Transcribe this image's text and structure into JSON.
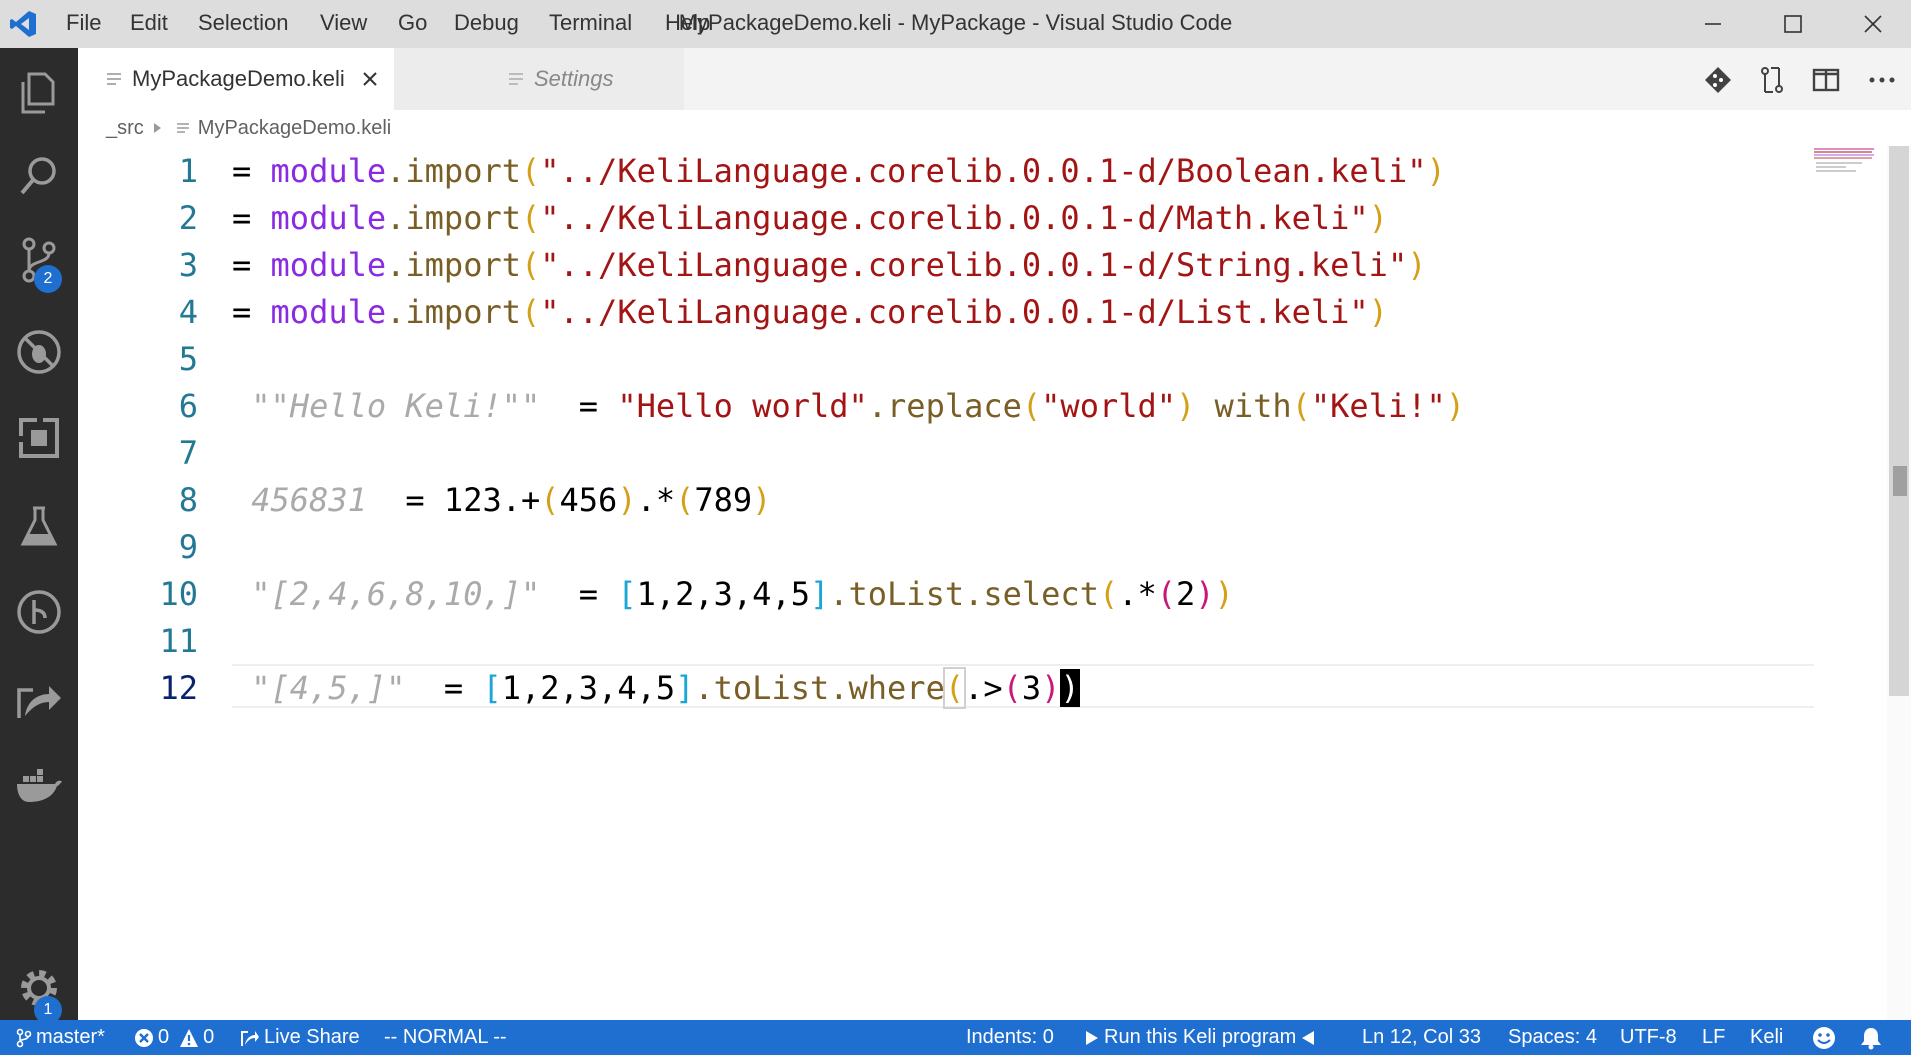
{
  "window": {
    "title": "MyPackageDemo.keli - MyPackage - Visual Studio Code",
    "app_icon": "vscode-icon"
  },
  "menu": [
    "File",
    "Edit",
    "Selection",
    "View",
    "Go",
    "Debug",
    "Terminal",
    "Help"
  ],
  "activity": {
    "items": [
      "explorer-icon",
      "search-icon",
      "source-control-icon",
      "debug-icon",
      "extensions-icon",
      "test-icon",
      "git-graph-icon",
      "live-share-icon",
      "docker-icon"
    ],
    "scm_badge": "2",
    "settings_badge": "1"
  },
  "tabs": [
    {
      "label": "MyPackageDemo.keli",
      "active": true
    },
    {
      "label": "Settings",
      "active": false
    }
  ],
  "breadcrumb": {
    "folder": "_src",
    "file": "MyPackageDemo.keli"
  },
  "editor": {
    "line_numbers": [
      "1",
      "2",
      "3",
      "4",
      "5",
      "6",
      "7",
      "8",
      "9",
      "10",
      "11",
      "12"
    ],
    "current_line": "12",
    "lines": [
      [
        {
          "t": "= ",
          "c": "eq"
        },
        {
          "t": "module",
          "c": "kw"
        },
        {
          "t": ".import",
          "c": "dot"
        },
        {
          "t": "(",
          "c": "p1"
        },
        {
          "t": "\"../KeliLanguage.corelib.0.0.1-d/Boolean.keli\"",
          "c": "str"
        },
        {
          "t": ")",
          "c": "p1"
        }
      ],
      [
        {
          "t": "= ",
          "c": "eq"
        },
        {
          "t": "module",
          "c": "kw"
        },
        {
          "t": ".import",
          "c": "dot"
        },
        {
          "t": "(",
          "c": "p1"
        },
        {
          "t": "\"../KeliLanguage.corelib.0.0.1-d/Math.keli\"",
          "c": "str"
        },
        {
          "t": ")",
          "c": "p1"
        }
      ],
      [
        {
          "t": "= ",
          "c": "eq"
        },
        {
          "t": "module",
          "c": "kw"
        },
        {
          "t": ".import",
          "c": "dot"
        },
        {
          "t": "(",
          "c": "p1"
        },
        {
          "t": "\"../KeliLanguage.corelib.0.0.1-d/String.keli\"",
          "c": "str"
        },
        {
          "t": ")",
          "c": "p1"
        }
      ],
      [
        {
          "t": "= ",
          "c": "eq"
        },
        {
          "t": "module",
          "c": "kw"
        },
        {
          "t": ".import",
          "c": "dot"
        },
        {
          "t": "(",
          "c": "p1"
        },
        {
          "t": "\"../KeliLanguage.corelib.0.0.1-d/List.keli\"",
          "c": "str"
        },
        {
          "t": ")",
          "c": "p1"
        }
      ],
      [],
      [
        {
          "t": " \"\"Hello Keli!\"\" ",
          "c": "res"
        },
        {
          "t": " = ",
          "c": "eq"
        },
        {
          "t": "\"Hello world\"",
          "c": "str"
        },
        {
          "t": ".replace",
          "c": "fn"
        },
        {
          "t": "(",
          "c": "p1"
        },
        {
          "t": "\"world\"",
          "c": "str"
        },
        {
          "t": ")",
          "c": "p1"
        },
        {
          "t": " with",
          "c": "fn"
        },
        {
          "t": "(",
          "c": "p1"
        },
        {
          "t": "\"Keli!\"",
          "c": "str"
        },
        {
          "t": ")",
          "c": "p1"
        }
      ],
      [],
      [
        {
          "t": " 456831 ",
          "c": "res"
        },
        {
          "t": " = ",
          "c": "eq"
        },
        {
          "t": "123.+",
          "c": "num"
        },
        {
          "t": "(",
          "c": "p1"
        },
        {
          "t": "456",
          "c": "num"
        },
        {
          "t": ")",
          "c": "p1"
        },
        {
          "t": ".*",
          "c": "num"
        },
        {
          "t": "(",
          "c": "p1"
        },
        {
          "t": "789",
          "c": "num"
        },
        {
          "t": ")",
          "c": "p1"
        }
      ],
      [],
      [
        {
          "t": " \"[2,4,6,8,10,]\" ",
          "c": "res"
        },
        {
          "t": " = ",
          "c": "eq"
        },
        {
          "t": "[",
          "c": "p3"
        },
        {
          "t": "1,2,3,4,5",
          "c": "num"
        },
        {
          "t": "]",
          "c": "p3"
        },
        {
          "t": ".toList.select",
          "c": "fn"
        },
        {
          "t": "(",
          "c": "p1"
        },
        {
          "t": ".*",
          "c": "num"
        },
        {
          "t": "(",
          "c": "p2"
        },
        {
          "t": "2",
          "c": "num"
        },
        {
          "t": ")",
          "c": "p2"
        },
        {
          "t": ")",
          "c": "p1"
        }
      ],
      [],
      [
        {
          "t": " \"[4,5,]\" ",
          "c": "res"
        },
        {
          "t": " = ",
          "c": "eq"
        },
        {
          "t": "[",
          "c": "p3"
        },
        {
          "t": "1,2,3,4,5",
          "c": "num"
        },
        {
          "t": "]",
          "c": "p3"
        },
        {
          "t": ".toList.where",
          "c": "fn"
        },
        {
          "t": "(",
          "c": "p1 match"
        },
        {
          "t": ".>",
          "c": "num"
        },
        {
          "t": "(",
          "c": "p2"
        },
        {
          "t": "3",
          "c": "num"
        },
        {
          "t": ")",
          "c": "p2"
        },
        {
          "t": ")",
          "c": "cursor"
        }
      ]
    ]
  },
  "status": {
    "branch": "master*",
    "errors": "0",
    "warnings": "0",
    "live_share": "Live Share",
    "vim_mode": "-- NORMAL --",
    "indents": "Indents: 0",
    "run": "Run this Keli program",
    "position": "Ln 12, Col 33",
    "spaces": "Spaces: 4",
    "encoding": "UTF-8",
    "eol": "LF",
    "language": "Keli"
  },
  "colors": {
    "status_bar": "#1f6fd0",
    "activity_bar": "#2c2c2c",
    "title_bar": "#dddddd"
  }
}
